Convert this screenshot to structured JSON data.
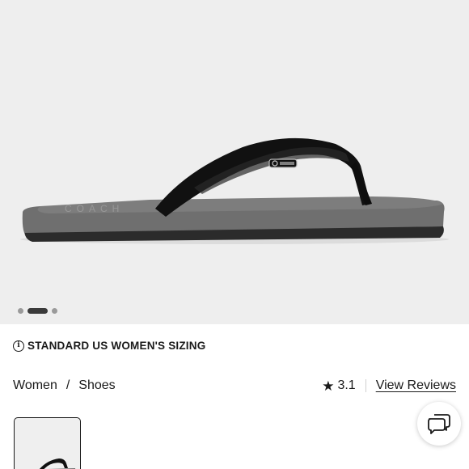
{
  "gallery": {
    "image_alt": "COACH flip flop sandal",
    "image_count": 3,
    "active_index": 1
  },
  "sizing": {
    "icon": "info-icon",
    "label": "STANDARD US WOMEN'S SIZING"
  },
  "breadcrumb": {
    "items": [
      "Women",
      "Shoes"
    ],
    "separator": "/"
  },
  "rating": {
    "icon": "star-icon",
    "value": "3.1",
    "reviews_link": "View Reviews"
  },
  "chat": {
    "icon": "chat-bubble-icon"
  },
  "colors": {
    "hero_bg": "#eeeeee",
    "sole": "#6f6f6f",
    "strap": "#111111",
    "text": "#1a1a1a"
  }
}
